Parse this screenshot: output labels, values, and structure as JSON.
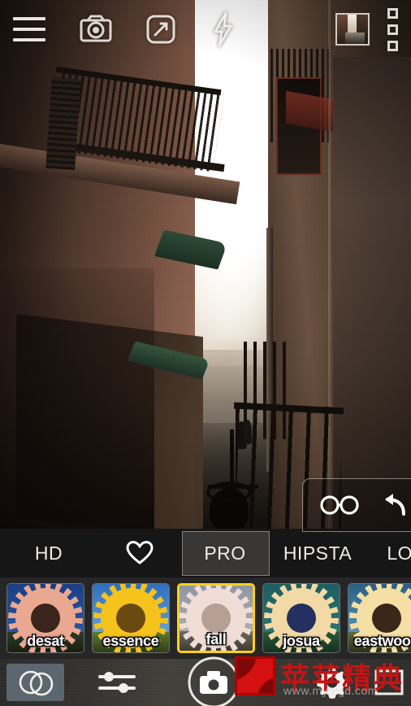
{
  "app": {
    "name": "camera-filter-app",
    "accent_selected": "#ffd11a",
    "bar_bg": "#262626"
  },
  "topbar": {
    "menu_icon": "hamburger-menu-icon",
    "lens_icon": "camera-lens-icon",
    "resize_icon": "expand-arrow-square-icon",
    "flash_icon": "flash-bolt-icon",
    "thumbnail_icon": "last-photo-thumbnail",
    "grid_icon": "three-squares-menu-icon"
  },
  "toolpanel": {
    "preview_icon": "compare-glasses-icon",
    "undo_icon": "undo-arrow-icon"
  },
  "tabs": [
    {
      "label": "HD",
      "name": "tab-hd",
      "selected": false,
      "kind": "text"
    },
    {
      "label": "",
      "name": "tab-favorites",
      "selected": false,
      "kind": "heart"
    },
    {
      "label": "PRO",
      "name": "tab-pro",
      "selected": true,
      "kind": "text"
    },
    {
      "label": "HIPSTA",
      "name": "tab-hipsta",
      "selected": false,
      "kind": "text"
    },
    {
      "label": "LOM",
      "name": "tab-lomo",
      "selected": false,
      "kind": "text"
    }
  ],
  "filters": [
    {
      "label": "desat",
      "selected": false,
      "sky": "linear-gradient(180deg,#1b3f86,#2f5fa8)",
      "grass": "linear-gradient(180deg,#2c3b2b,#17200f)",
      "petal": "#eba890",
      "core": "#3a241c"
    },
    {
      "label": "essence",
      "selected": false,
      "sky": "linear-gradient(180deg,#2f6fbe,#7fb2dd)",
      "grass": "linear-gradient(180deg,#5e7a32,#2d3d17)",
      "petal": "#f5c31b",
      "core": "#6b4a12"
    },
    {
      "label": "fall",
      "selected": true,
      "sky": "linear-gradient(180deg,#8e96a4,#b7b6b2)",
      "grass": "linear-gradient(180deg,#6f6a60,#3f3b35)",
      "petal": "#f0ddd6",
      "core": "#b79f96"
    },
    {
      "label": "josua",
      "selected": false,
      "sky": "linear-gradient(180deg,#1f5e63,#2e7e74)",
      "grass": "linear-gradient(180deg,#2a5a3c,#15301f)",
      "petal": "#f3d9a6",
      "core": "#24305f"
    },
    {
      "label": "eastwood",
      "selected": false,
      "sky": "linear-gradient(180deg,#2a5f84,#69a8c5)",
      "grass": "linear-gradient(180deg,#5e6a35,#2b3318)",
      "petal": "#f6dfa4",
      "core": "#3b261a"
    },
    {
      "label": "",
      "selected": false,
      "sky": "linear-gradient(180deg,#1d4f93,#4d89c4)",
      "grass": "linear-gradient(180deg,#4f6a33,#23310f)",
      "petal": "#f2cb52",
      "core": "#5a3e14"
    }
  ],
  "bottombar": {
    "blend_icon": "overlapping-circles-blend-icon",
    "adjust_icon": "sliders-adjust-icon",
    "shutter_icon": "camera-shutter-icon",
    "settings_icon": "gear-settings-icon",
    "frame_icon": "frame-square-icon"
  },
  "watermark": {
    "text_cn": "苹苹精典",
    "url": "www.myqqjd.com",
    "logo": "red-square-logo",
    "color": "#c41414"
  }
}
